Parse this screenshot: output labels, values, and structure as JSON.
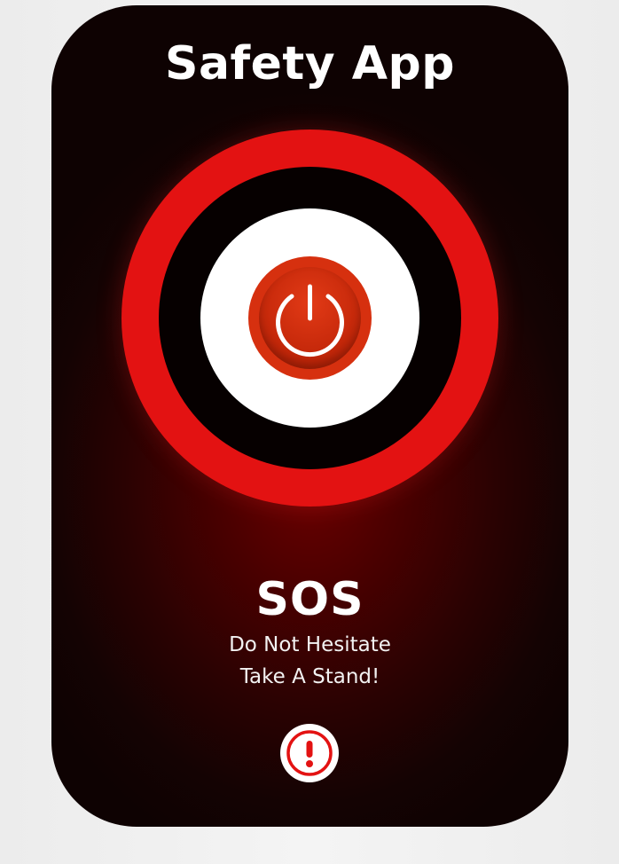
{
  "app": {
    "title": "Safety App"
  },
  "sos": {
    "title": "SOS",
    "tagline_line1": "Do Not Hesitate",
    "tagline_line2": "Take A Stand!"
  },
  "icons": {
    "power": "power-icon",
    "alert": "exclamation-circle-icon"
  },
  "colors": {
    "ring_red": "#e31212",
    "ring_black": "#060000",
    "disc_white": "#ffffff",
    "power_button": "#d6300f",
    "alert_red": "#e31212",
    "background_dark": "#140303",
    "background_glow": "#6b0000"
  }
}
